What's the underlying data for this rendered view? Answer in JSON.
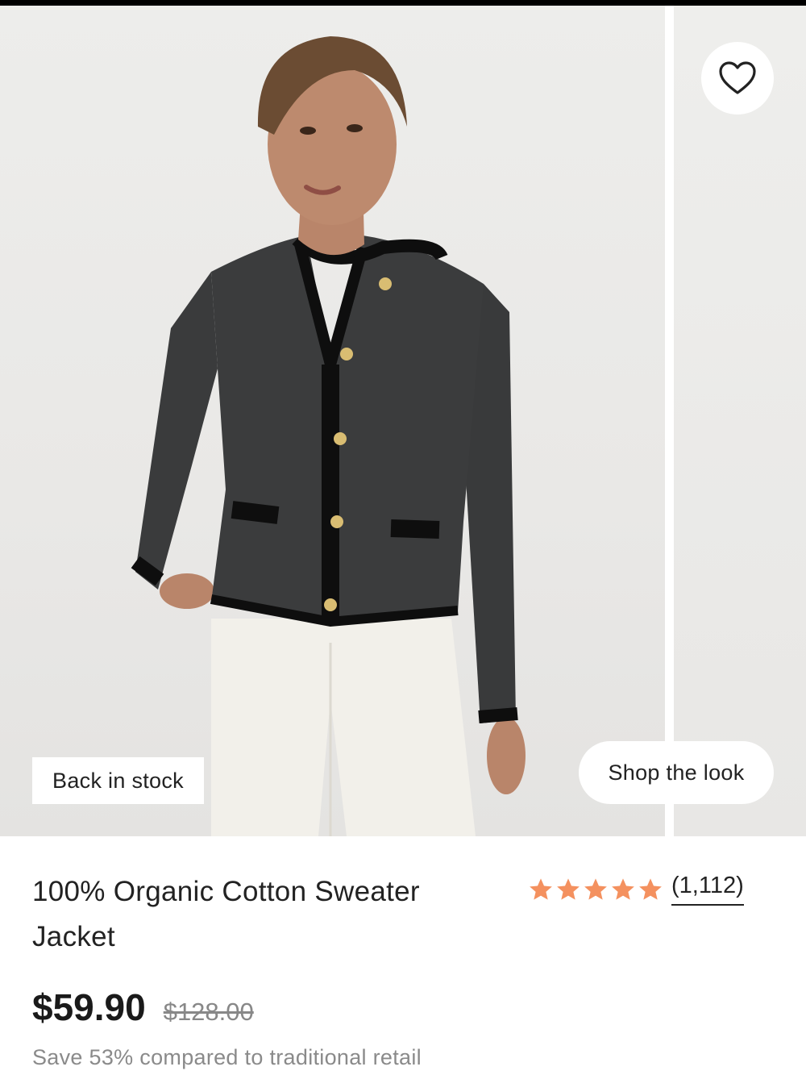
{
  "gallery": {
    "badge": "Back in stock",
    "shop_the_look": "Shop the look",
    "wishlist_icon": "heart-icon"
  },
  "product": {
    "title": "100% Organic Cotton Sweater Jacket",
    "rating": 5,
    "rating_count": "(1,112)",
    "price": "$59.90",
    "original_price": "$128.00",
    "savings": "Save 53% compared to traditional retail"
  },
  "colors": {
    "star": "#f4915f",
    "text": "#222222",
    "muted": "#8a8a8a"
  }
}
